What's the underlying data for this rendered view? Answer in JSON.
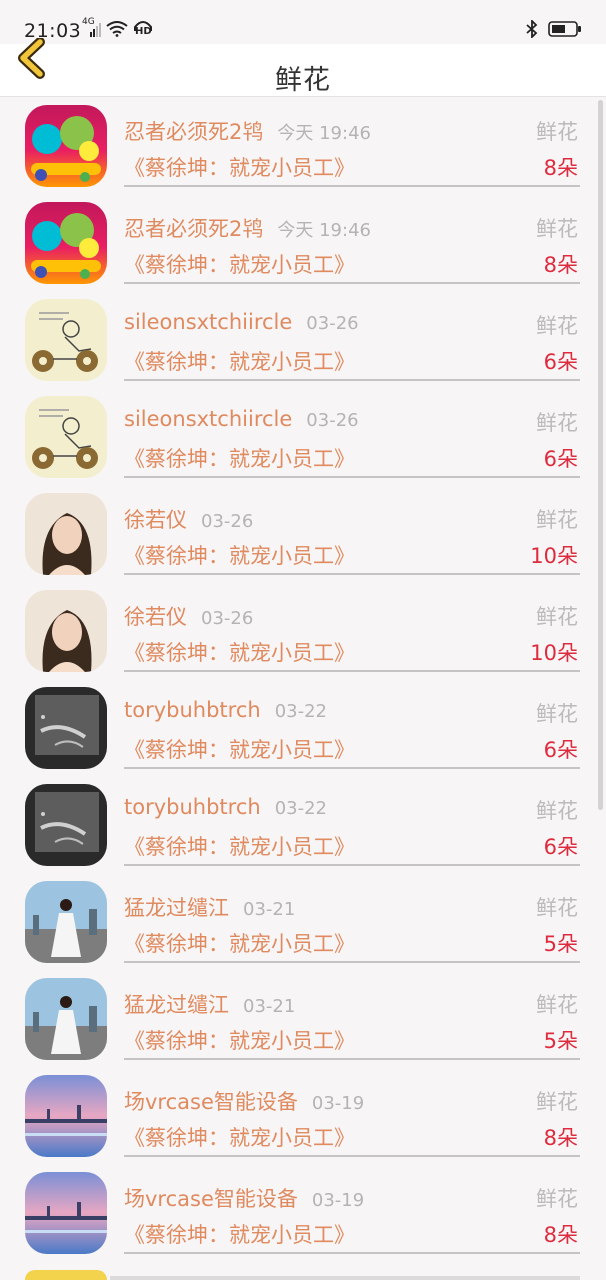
{
  "status_bar": {
    "time": "21:03",
    "network": "4G",
    "hd": "HD"
  },
  "header": {
    "title": "鲜花",
    "back_icon": "chevron-left-icon",
    "accent_color": "#f2c63a"
  },
  "colors": {
    "name": "#e08a5f",
    "count": "#de2b3d",
    "muted": "#bdbabb"
  },
  "rows": [
    {
      "name": "忍者必须死2鸨",
      "date": "今天 19:46",
      "gift": "鲜花",
      "book": "《蔡徐坤：就宠小员工》",
      "count": "8朵",
      "avatar": "game-art"
    },
    {
      "name": "忍者必须死2鸨",
      "date": "今天 19:46",
      "gift": "鲜花",
      "book": "《蔡徐坤：就宠小员工》",
      "count": "8朵",
      "avatar": "game-art"
    },
    {
      "name": "sileonsxtchiircle",
      "date": "03-26",
      "gift": "鲜花",
      "book": "《蔡徐坤：就宠小员工》",
      "count": "6朵",
      "avatar": "sketch-bike"
    },
    {
      "name": "sileonsxtchiircle",
      "date": "03-26",
      "gift": "鲜花",
      "book": "《蔡徐坤：就宠小员工》",
      "count": "6朵",
      "avatar": "sketch-bike"
    },
    {
      "name": "徐若仪",
      "date": "03-26",
      "gift": "鲜花",
      "book": "《蔡徐坤：就宠小员工》",
      "count": "10朵",
      "avatar": "portrait"
    },
    {
      "name": "徐若仪",
      "date": "03-26",
      "gift": "鲜花",
      "book": "《蔡徐坤：就宠小员工》",
      "count": "10朵",
      "avatar": "portrait"
    },
    {
      "name": "torybuhbtrch",
      "date": "03-22",
      "gift": "鲜花",
      "book": "《蔡徐坤：就宠小员工》",
      "count": "6朵",
      "avatar": "bw-hand"
    },
    {
      "name": "torybuhbtrch",
      "date": "03-22",
      "gift": "鲜花",
      "book": "《蔡徐坤：就宠小员工》",
      "count": "6朵",
      "avatar": "bw-hand"
    },
    {
      "name": "猛龙过缱江",
      "date": "03-21",
      "gift": "鲜花",
      "book": "《蔡徐坤：就宠小员工》",
      "count": "5朵",
      "avatar": "girl-road"
    },
    {
      "name": "猛龙过缱江",
      "date": "03-21",
      "gift": "鲜花",
      "book": "《蔡徐坤：就宠小员工》",
      "count": "5朵",
      "avatar": "girl-road"
    },
    {
      "name": "场vrcase智能设备",
      "date": "03-19",
      "gift": "鲜花",
      "book": "《蔡徐坤：就宠小员工》",
      "count": "8朵",
      "avatar": "seaside"
    },
    {
      "name": "场vrcase智能设备",
      "date": "03-19",
      "gift": "鲜花",
      "book": "《蔡徐坤：就宠小员工》",
      "count": "8朵",
      "avatar": "seaside"
    }
  ]
}
